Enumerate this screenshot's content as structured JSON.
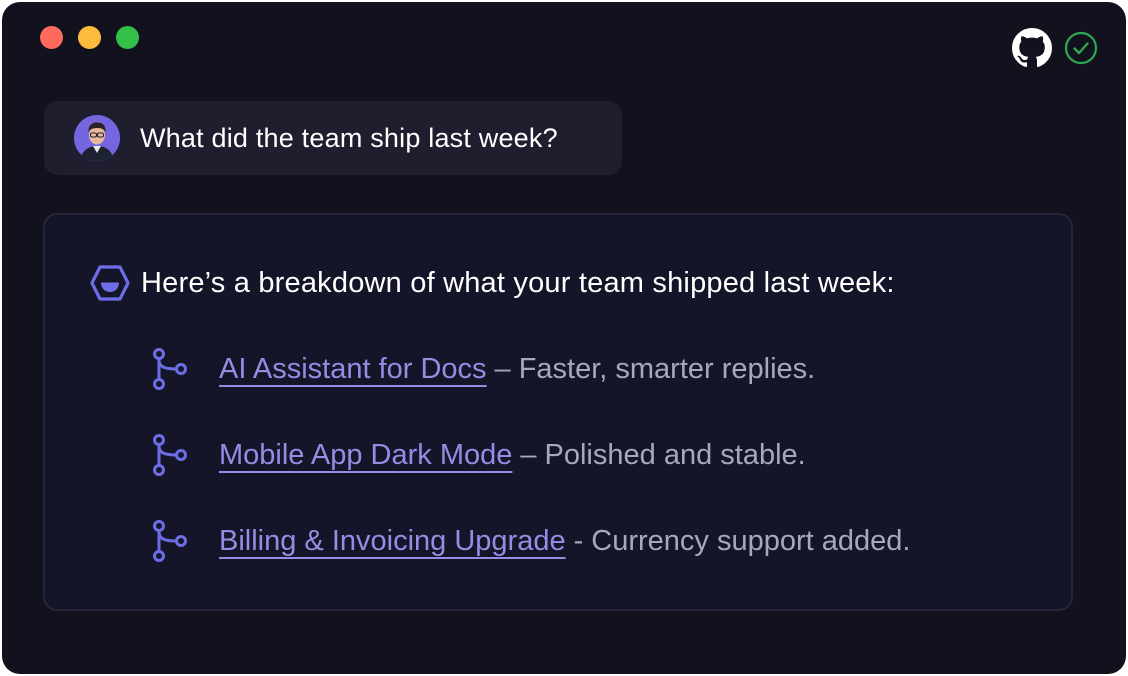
{
  "window": {
    "controls": [
      "close",
      "minimize",
      "maximize"
    ],
    "colors": {
      "close": "#fe6a5e",
      "minimize": "#fdbc3e",
      "maximize": "#33c049"
    }
  },
  "header": {
    "icons": [
      "github-icon",
      "check-circle-icon"
    ],
    "status_color": "#2fa84f"
  },
  "user_message": {
    "avatar_icon": "user-avatar",
    "text": "What did the team ship last week?"
  },
  "answer": {
    "icon": "assistant-logo-icon",
    "title": "Here’s a breakdown of what your team shipped last week:",
    "accent": "#6e6de8",
    "items": [
      {
        "icon": "git-branch-icon",
        "link": "AI Assistant for Docs",
        "separator": "–",
        "description": "Faster, smarter replies."
      },
      {
        "icon": "git-branch-icon",
        "link": "Mobile App Dark Mode",
        "separator": "–",
        "description": "Polished and stable."
      },
      {
        "icon": "git-branch-icon",
        "link": "Billing & Invoicing Upgrade",
        "separator": "-",
        "description": "Currency support added."
      }
    ]
  }
}
